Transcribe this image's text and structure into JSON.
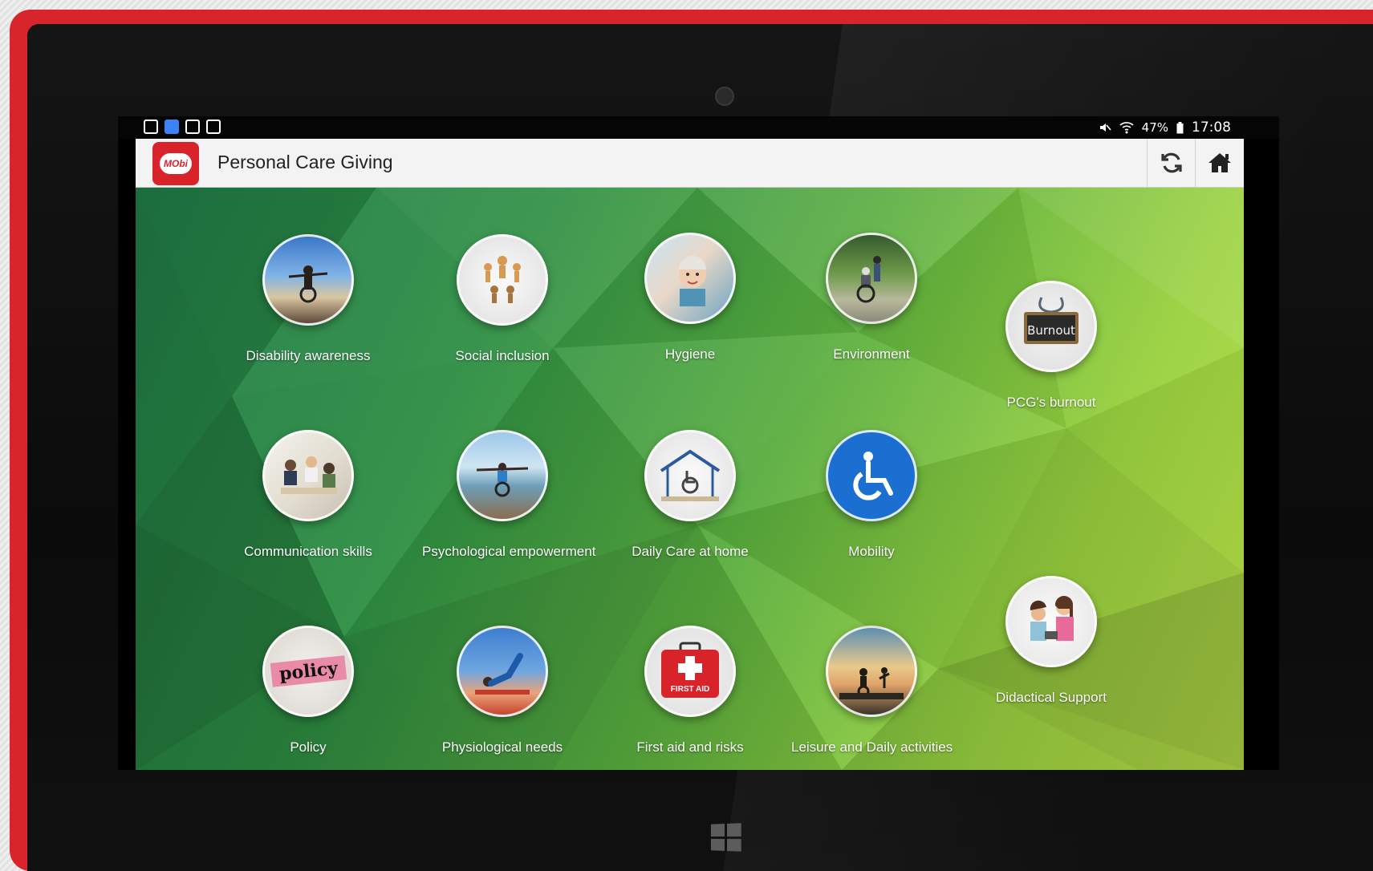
{
  "app": {
    "title": "Personal Care Giving",
    "logo_text": "MObi"
  },
  "statusbar": {
    "battery": "47%",
    "time": "17:08"
  },
  "colors": {
    "device_frame": "#d8252b",
    "app_logo": "#d9232a",
    "background_gradient_start": "#1f7a46",
    "background_gradient_end": "#b9e04a"
  },
  "tiles": [
    {
      "label": "Disability awareness",
      "icon": "wheelchair-beach-icon"
    },
    {
      "label": "Social inclusion",
      "icon": "paper-people-chain-icon"
    },
    {
      "label": "Hygiene",
      "icon": "elderly-woman-icon"
    },
    {
      "label": "Environment",
      "icon": "wheelchair-park-icon"
    },
    {
      "label": "PCG's burnout",
      "icon": "burnout-sign-icon",
      "sign_text": "Burnout"
    },
    {
      "label": "Communication skills",
      "icon": "group-meeting-icon"
    },
    {
      "label": "Psychological empowerment",
      "icon": "wheelchair-pier-icon"
    },
    {
      "label": "Daily Care at home",
      "icon": "house-wheelchair-icon"
    },
    {
      "label": "Mobility",
      "icon": "accessibility-sign-icon"
    },
    {
      "label": "Policy",
      "icon": "policy-word-icon",
      "image_text": "policy"
    },
    {
      "label": "Physiological needs",
      "icon": "yoga-stretch-icon"
    },
    {
      "label": "First aid and risks",
      "icon": "first-aid-kit-icon",
      "image_text": "FIRST AID"
    },
    {
      "label": "Leisure and Daily activities",
      "icon": "sunset-silhouette-icon"
    },
    {
      "label": "Didactical Support",
      "icon": "caregivers-icon"
    }
  ]
}
